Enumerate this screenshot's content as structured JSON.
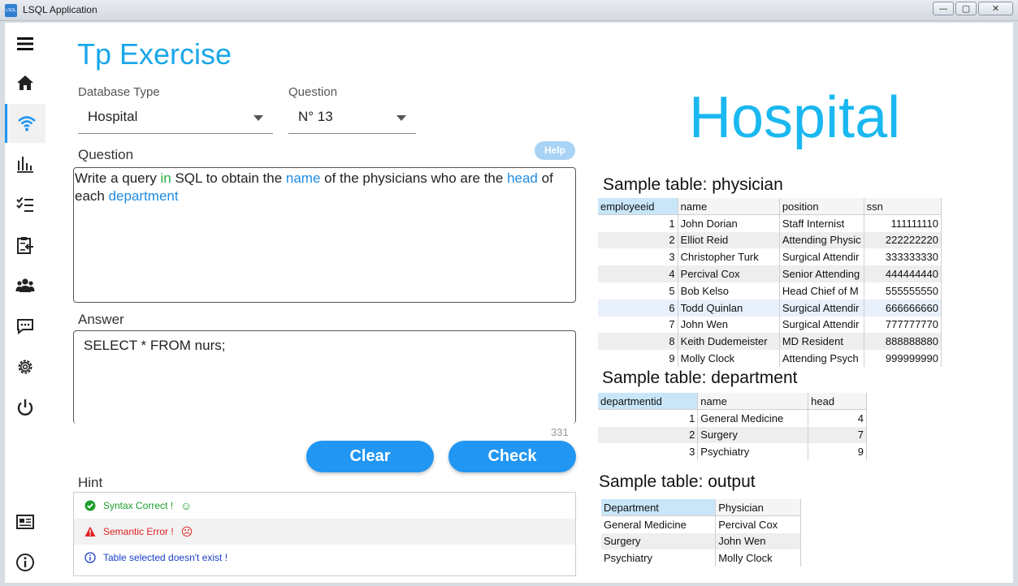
{
  "window": {
    "title": "LSQL Application",
    "app_icon_text": "LSQL",
    "min": "—",
    "max": "▢",
    "close": "✕"
  },
  "sidebar": {
    "items": [
      {
        "icon": "menu-icon"
      },
      {
        "icon": "home-icon"
      },
      {
        "icon": "wifi-icon"
      },
      {
        "icon": "bar-chart-icon"
      },
      {
        "icon": "checklist-icon"
      },
      {
        "icon": "clipboard-icon"
      },
      {
        "icon": "users-icon"
      },
      {
        "icon": "chat-icon"
      },
      {
        "icon": "gear-icon"
      },
      {
        "icon": "power-icon"
      },
      {
        "icon": "news-icon"
      },
      {
        "icon": "info-icon"
      }
    ],
    "active": "wifi-icon",
    "accent": "#2196f3"
  },
  "page_title": "Tp Exercise",
  "db_type": {
    "label": "Database Type",
    "value": "Hospital"
  },
  "question_select": {
    "label": "Question",
    "value": "N° 13"
  },
  "question": {
    "label": "Question",
    "help": "Help",
    "parts": [
      {
        "t": "Write a query ",
        "c": ""
      },
      {
        "t": "in",
        "c": "g"
      },
      {
        "t": " SQL to obtain the ",
        "c": ""
      },
      {
        "t": "name",
        "c": "b"
      },
      {
        "t": " of the physicians who are the ",
        "c": ""
      },
      {
        "t": "head",
        "c": "b"
      },
      {
        "t": " of each ",
        "c": ""
      },
      {
        "t": "department",
        "c": "b"
      }
    ]
  },
  "answer": {
    "label": "Answer",
    "value": "SELECT * FROM nurs;",
    "remaining": "331"
  },
  "buttons": {
    "clear": "Clear",
    "check": "Check"
  },
  "hint": {
    "label": "Hint",
    "items": [
      {
        "icon": "check-circle-icon",
        "text": "Syntax Correct !",
        "face": "☺",
        "color": "#1e9e2e"
      },
      {
        "icon": "warning-icon",
        "text": "Semantic Error !",
        "face": "☹",
        "color": "#e02020"
      },
      {
        "icon": "info-circle-icon",
        "text": "Table selected doesn't exist !",
        "face": "",
        "color": "#1a3ec8"
      }
    ]
  },
  "db_title": "Hospital",
  "physician": {
    "title": "Sample table: physician",
    "columns": [
      "employeeid",
      "name",
      "position",
      "ssn"
    ],
    "rows": [
      [
        "1",
        "John Dorian",
        "Staff Internist",
        "111111110"
      ],
      [
        "2",
        "Elliot Reid",
        "Attending Physic",
        "222222220"
      ],
      [
        "3",
        "Christopher Turk",
        "Surgical Attendir",
        "333333330"
      ],
      [
        "4",
        "Percival Cox",
        "Senior Attending",
        "444444440"
      ],
      [
        "5",
        "Bob Kelso",
        "Head Chief of M",
        "555555550"
      ],
      [
        "6",
        "Todd Quinlan",
        "Surgical Attendir",
        "666666660"
      ],
      [
        "7",
        "John Wen",
        "Surgical Attendir",
        "777777770"
      ],
      [
        "8",
        "Keith Dudemeister",
        "MD Resident",
        "888888880"
      ],
      [
        "9",
        "Molly Clock",
        "Attending Psych",
        "999999990"
      ]
    ]
  },
  "department": {
    "title": "Sample table: department",
    "columns": [
      "departmentid",
      "name",
      "head"
    ],
    "rows": [
      [
        "1",
        "General Medicine",
        "4"
      ],
      [
        "2",
        "Surgery",
        "7"
      ],
      [
        "3",
        "Psychiatry",
        "9"
      ]
    ]
  },
  "output": {
    "title": "Sample table: output",
    "columns": [
      "Department",
      "Physician"
    ],
    "rows": [
      [
        "General Medicine",
        "Percival Cox"
      ],
      [
        "Surgery",
        "John Wen"
      ],
      [
        "Psychiatry",
        "Molly Clock"
      ]
    ]
  }
}
